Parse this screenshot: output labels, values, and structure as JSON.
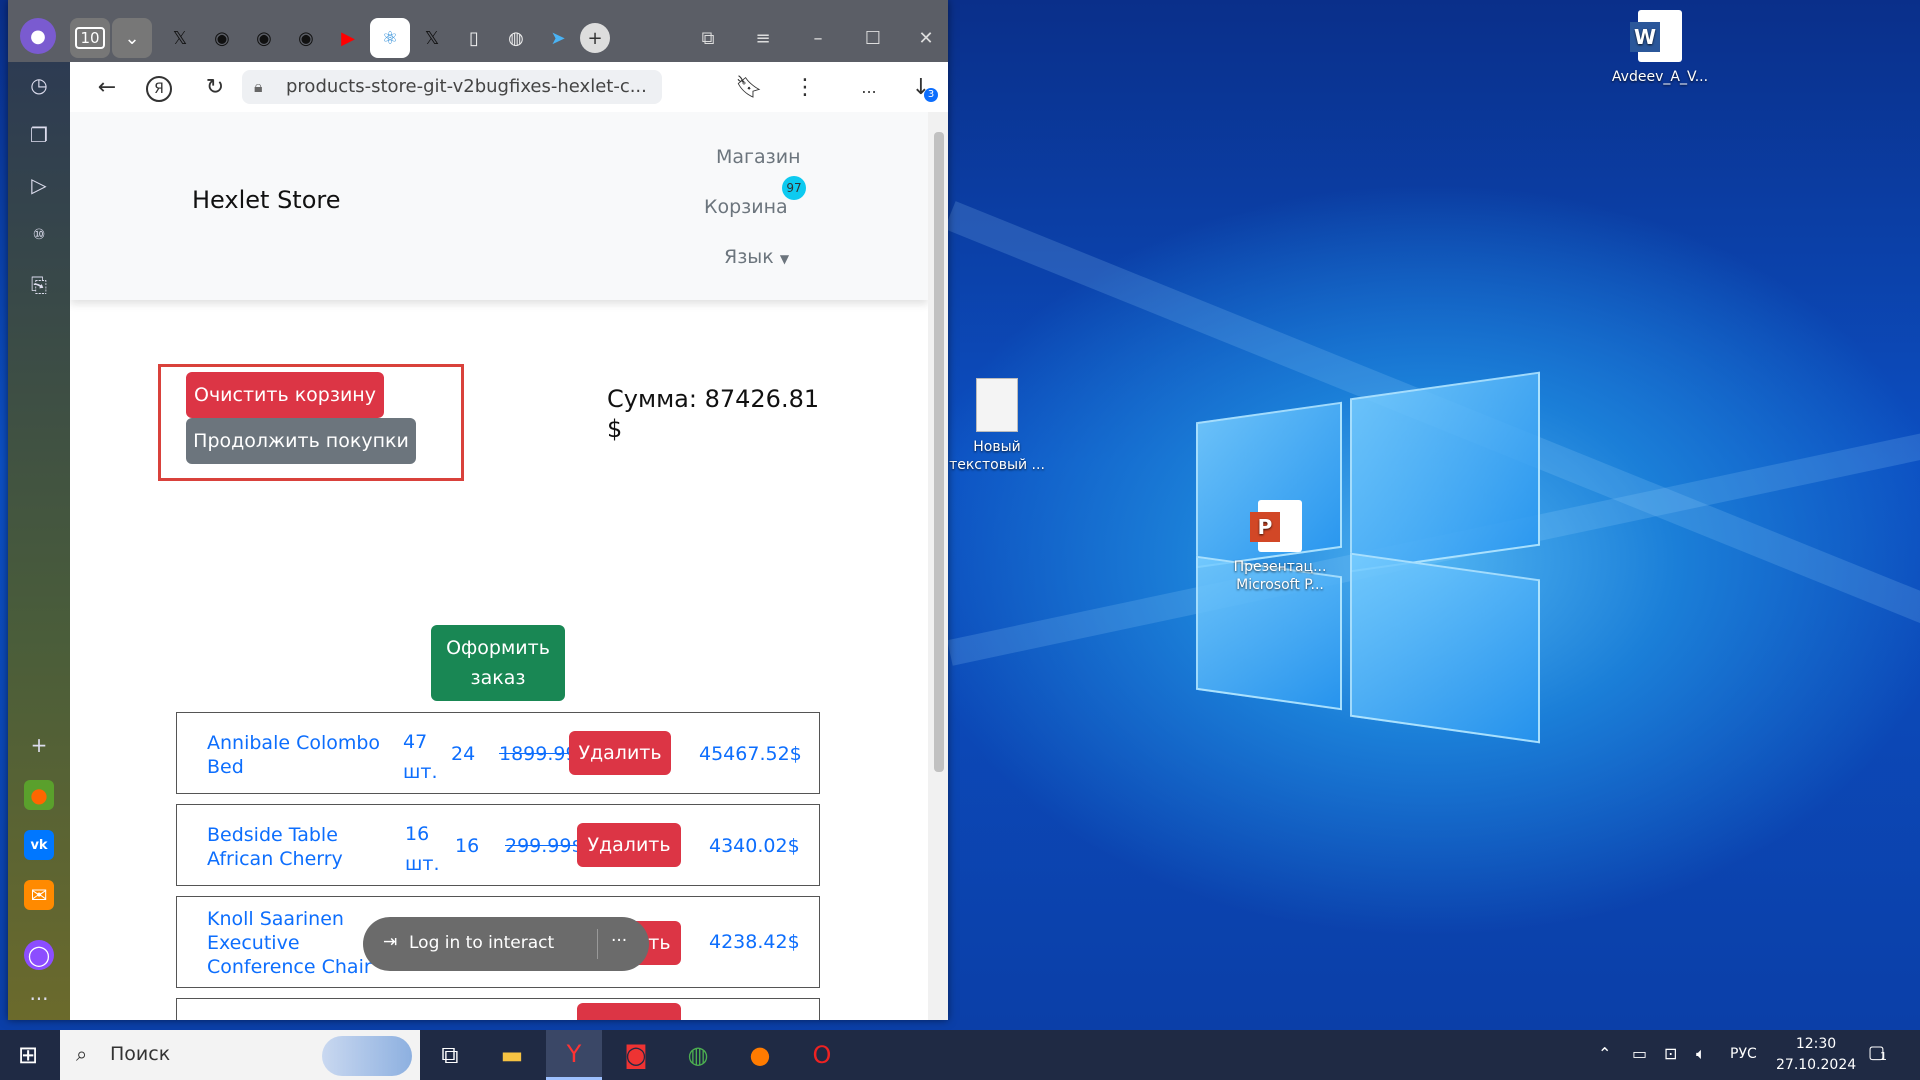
{
  "browser": {
    "tab_count": "10",
    "address": "products-store-git-v2bugfixes-hexlet-c...",
    "downloads_badge": "3",
    "more_label": "..."
  },
  "store": {
    "brand": "Hexlet Store",
    "nav_shop": "Магазин",
    "nav_cart": "Корзина",
    "cart_count": "97",
    "nav_language": "Язык",
    "clear_cart": "Очистить корзину",
    "continue_shopping": "Продолжить покупки",
    "sum_label": "Сумма: 87426.81",
    "sum_currency": "$",
    "checkout": "Оформить заказ",
    "items": [
      {
        "name_l1": "Annibale Colombo",
        "name_l2": "Bed",
        "qty": "47",
        "unit": "шт.",
        "stock": "24",
        "price": "1899.99$",
        "delete": "Удалить",
        "total": "45467.52$"
      },
      {
        "name_l1": "Bedside Table",
        "name_l2": "African Cherry",
        "qty": "16",
        "unit": "шт.",
        "stock": "16",
        "price": "299.99$",
        "delete": "Удалить",
        "total": "4340.02$"
      },
      {
        "name_l1": "Knoll Saarinen",
        "name_l2": "Executive",
        "name_l3": "Conference Chair",
        "delete": "Удалить",
        "total": "4238.42$"
      }
    ]
  },
  "overlay": {
    "login": "Log in to interact",
    "more": "···"
  },
  "desktop": {
    "word_file": "Avdeev_A_V...",
    "text_file_l1": "Новый",
    "text_file_l2": "текстовый ...",
    "ppt_file_l1": "Презентац...",
    "ppt_file_l2": "Microsoft P..."
  },
  "taskbar": {
    "search": "Поиск",
    "lang": "РУС",
    "time": "12:30",
    "date": "27.10.2024",
    "notifications": "1"
  }
}
